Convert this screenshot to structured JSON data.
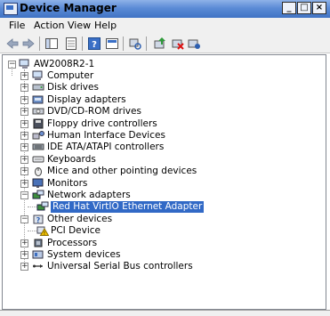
{
  "window": {
    "title": "Device Manager"
  },
  "window_buttons": {
    "minimize": "_",
    "maximize": "□",
    "close": "×"
  },
  "menu": [
    "File",
    "Action",
    "View",
    "Help"
  ],
  "tree": {
    "root": "AW2008R2-1",
    "nodes": [
      {
        "label": "Computer",
        "expander": "+",
        "icon": "computer-icon"
      },
      {
        "label": "Disk drives",
        "expander": "+",
        "icon": "disk-icon"
      },
      {
        "label": "Display adapters",
        "expander": "+",
        "icon": "display-icon"
      },
      {
        "label": "DVD/CD-ROM drives",
        "expander": "+",
        "icon": "dvd-icon"
      },
      {
        "label": "Floppy drive controllers",
        "expander": "+",
        "icon": "floppy-icon"
      },
      {
        "label": "Human Interface Devices",
        "expander": "+",
        "icon": "hid-icon"
      },
      {
        "label": "IDE ATA/ATAPI controllers",
        "expander": "+",
        "icon": "ide-icon"
      },
      {
        "label": "Keyboards",
        "expander": "+",
        "icon": "keyboard-icon"
      },
      {
        "label": "Mice and other pointing devices",
        "expander": "+",
        "icon": "mouse-icon"
      },
      {
        "label": "Monitors",
        "expander": "+",
        "icon": "monitor-icon"
      },
      {
        "label": "Network adapters",
        "expander": "−",
        "icon": "network-icon"
      },
      {
        "label": "Red Hat VirtIO Ethernet Adapter",
        "child": true,
        "selected": true,
        "icon": "network-adapter-icon"
      },
      {
        "label": "Other devices",
        "expander": "−",
        "icon": "other-devices-icon"
      },
      {
        "label": "PCI Device",
        "child": true,
        "icon": "warning-device-icon"
      },
      {
        "label": "Processors",
        "expander": "+",
        "icon": "processor-icon"
      },
      {
        "label": "System devices",
        "expander": "+",
        "icon": "system-icon"
      },
      {
        "label": "Universal Serial Bus controllers",
        "expander": "+",
        "icon": "usb-icon"
      }
    ]
  },
  "colors": {
    "selection": "#3169c6",
    "titlebar": "#5b8bd6",
    "warning": "#f2c200"
  }
}
